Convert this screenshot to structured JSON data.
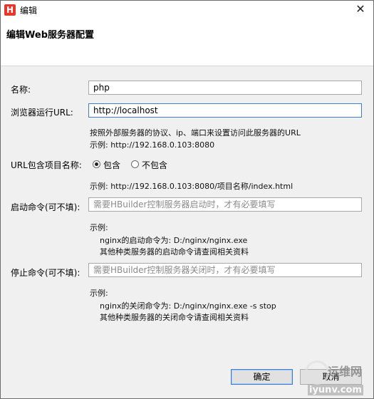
{
  "window": {
    "title": "编辑",
    "close_glyph": "✕"
  },
  "header": {
    "title": "编辑Web服务器配置"
  },
  "form": {
    "name": {
      "label": "名称:",
      "value": "php"
    },
    "url": {
      "label": "浏览器运行URL:",
      "value": "http://localhost"
    },
    "url_hint": {
      "line1": "按照外部服务器的协议、ip、端口来设置访问此服务器的URL",
      "line2": "示例:    http://192.168.0.103:8080"
    },
    "include_project": {
      "label": "URL包含项目名称:",
      "option_include": "包含",
      "option_exclude": "不包含",
      "selected": "包含"
    },
    "include_hint": "示例:    http://192.168.0.103:8080/项目名称/index.html",
    "start_cmd": {
      "label": "启动命令(可不填):",
      "placeholder": "需要HBuilder控制服务器启动时，才有必要填写"
    },
    "start_hint": {
      "line1": "示例:",
      "line2": "nginx的启动命令为:  D:/nginx/nginx.exe",
      "line3": "其他种类服务器的启动命令请查阅相关资料"
    },
    "stop_cmd": {
      "label": "停止命令(可不填):",
      "placeholder": "需要HBuilder控制服务器关闭时，才有必要填写"
    },
    "stop_hint": {
      "line1": "示例:",
      "line2": "nginx的关闭命令为:  D:/nginx/nginx.exe -s stop",
      "line3": "其他种类服务器的关闭命令请查阅相关资料"
    }
  },
  "buttons": {
    "ok": "确定",
    "cancel": "取消"
  },
  "watermark": {
    "text1": "运维网",
    "text2": "iyunv.com"
  }
}
